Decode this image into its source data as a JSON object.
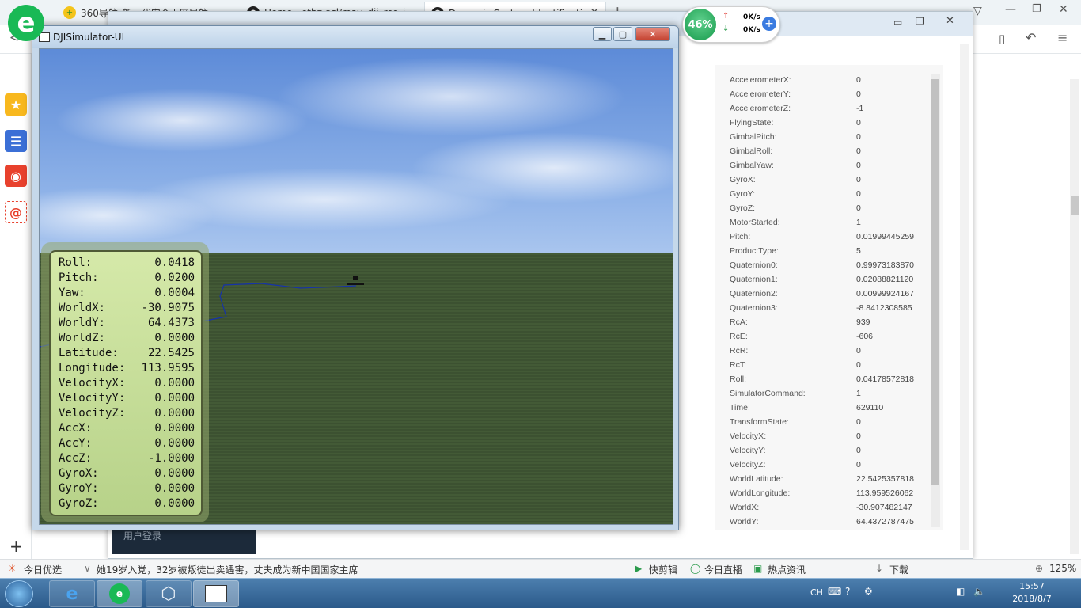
{
  "browser": {
    "tabs": [
      {
        "label": "360导航_新一代安全上网导航"
      },
      {
        "label": "Home · ethz-asl/mav_dji_ros_i"
      },
      {
        "label": "Dynamic System Identification"
      }
    ],
    "new_tab": "+",
    "speed": {
      "percent": "46%",
      "up": "0K/s",
      "down": "0K/s"
    },
    "statusbar": {
      "left": "今日优选",
      "news": "她19岁入党，32岁被叛徒出卖遇害，丈夫成为新中国国家主席",
      "kuaijianji": "快剪辑",
      "live": "今日直播",
      "hot": "热点资讯",
      "download": "下载",
      "zoom": "125%"
    },
    "login": "用户登录"
  },
  "simulator": {
    "title": "DJISimulator-UI",
    "hud": [
      {
        "k": "Roll:",
        "v": "0.0418"
      },
      {
        "k": "Pitch:",
        "v": "0.0200"
      },
      {
        "k": "Yaw:",
        "v": "0.0004"
      },
      {
        "k": "WorldX:",
        "v": "-30.9075"
      },
      {
        "k": "WorldY:",
        "v": "64.4373"
      },
      {
        "k": "WorldZ:",
        "v": "0.0000"
      },
      {
        "k": "Latitude:",
        "v": "22.5425"
      },
      {
        "k": "Longitude:",
        "v": "113.9595"
      },
      {
        "k": "VelocityX:",
        "v": "0.0000"
      },
      {
        "k": "VelocityY:",
        "v": "0.0000"
      },
      {
        "k": "VelocityZ:",
        "v": "0.0000"
      },
      {
        "k": "AccX:",
        "v": "0.0000"
      },
      {
        "k": "AccY:",
        "v": "0.0000"
      },
      {
        "k": "AccZ:",
        "v": "-1.0000"
      },
      {
        "k": "GyroX:",
        "v": "0.0000"
      },
      {
        "k": "GyroY:",
        "v": "0.0000"
      },
      {
        "k": "GyroZ:",
        "v": "0.0000"
      }
    ]
  },
  "data_table": [
    {
      "k": "AccelerometerX:",
      "v": "0"
    },
    {
      "k": "AccelerometerY:",
      "v": "0"
    },
    {
      "k": "AccelerometerZ:",
      "v": "-1"
    },
    {
      "k": "FlyingState:",
      "v": "0"
    },
    {
      "k": "GimbalPitch:",
      "v": "0"
    },
    {
      "k": "GimbalRoll:",
      "v": "0"
    },
    {
      "k": "GimbalYaw:",
      "v": "0"
    },
    {
      "k": "GyroX:",
      "v": "0"
    },
    {
      "k": "GyroY:",
      "v": "0"
    },
    {
      "k": "GyroZ:",
      "v": "0"
    },
    {
      "k": "MotorStarted:",
      "v": "1"
    },
    {
      "k": "Pitch:",
      "v": "0.01999445259"
    },
    {
      "k": "ProductType:",
      "v": "5"
    },
    {
      "k": "Quaternion0:",
      "v": "0.99973183870"
    },
    {
      "k": "Quaternion1:",
      "v": "0.02088821120"
    },
    {
      "k": "Quaternion2:",
      "v": "0.00999924167"
    },
    {
      "k": "Quaternion3:",
      "v": "-8.8412308585"
    },
    {
      "k": "RcA:",
      "v": "939"
    },
    {
      "k": "RcE:",
      "v": "-606"
    },
    {
      "k": "RcR:",
      "v": "0"
    },
    {
      "k": "RcT:",
      "v": "0"
    },
    {
      "k": "Roll:",
      "v": "0.04178572818"
    },
    {
      "k": "SimulatorCommand:",
      "v": "1"
    },
    {
      "k": "Time:",
      "v": "629110"
    },
    {
      "k": "TransformState:",
      "v": "0"
    },
    {
      "k": "VelocityX:",
      "v": "0"
    },
    {
      "k": "VelocityY:",
      "v": "0"
    },
    {
      "k": "VelocityZ:",
      "v": "0"
    },
    {
      "k": "WorldLatitude:",
      "v": "22.5425357818"
    },
    {
      "k": "WorldLongitude:",
      "v": "113.959526062"
    },
    {
      "k": "WorldX:",
      "v": "-30.907482147"
    },
    {
      "k": "WorldY:",
      "v": "64.4372787475"
    }
  ],
  "taskbar": {
    "time": "15:57",
    "date": "2018/8/7",
    "lang": "CH"
  }
}
